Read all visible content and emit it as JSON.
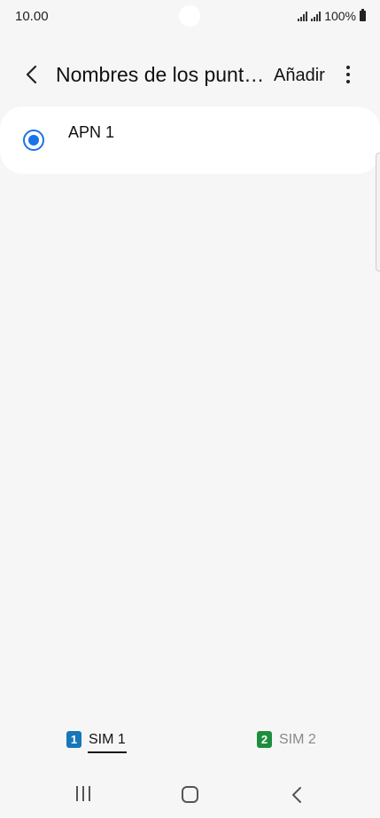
{
  "status_bar": {
    "time": "10.00",
    "battery": "100%"
  },
  "app_bar": {
    "title": "Nombres de los punt…",
    "add_label": "Añadir"
  },
  "apn_list": {
    "items": [
      {
        "label": "APN 1",
        "selected": true
      }
    ]
  },
  "sim_tabs": {
    "sim1": {
      "badge": "1",
      "label": "SIM 1",
      "color": "#1676b8",
      "active": true
    },
    "sim2": {
      "badge": "2",
      "label": "SIM 2",
      "color": "#1e8e3e",
      "active": false
    }
  },
  "colors": {
    "accent": "#1a73e8",
    "background": "#f6f6f6"
  },
  "icons": {
    "back": "chevron-left-icon",
    "more": "more-vertical-icon",
    "nav_recents": "recents-icon",
    "nav_home": "home-icon",
    "nav_back": "back-icon"
  }
}
